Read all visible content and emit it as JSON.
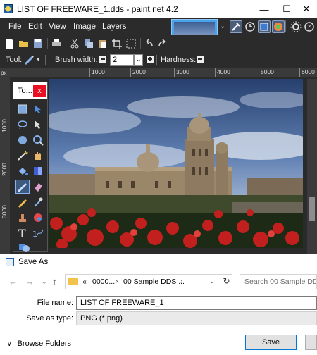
{
  "window": {
    "title": "LIST OF FREEWARE_1.dds - paint.net 4.2",
    "controls": {
      "minimize": "—",
      "maximize": "☐",
      "close": "✕"
    }
  },
  "menu": [
    "File",
    "Edit",
    "View",
    "Image",
    "Layers"
  ],
  "toolbar2": {
    "tool_label": "Tool:",
    "brush_width_label": "Brush width:",
    "brush_width_value": "2",
    "hardness_label": "Hardness:"
  },
  "ruler": {
    "unit": "px",
    "h_ticks": [
      "1000",
      "2000",
      "3000",
      "4000",
      "5000",
      "6000"
    ],
    "v_ticks": [
      "1000",
      "2000",
      "3000"
    ]
  },
  "tools_palette": {
    "title": "To...",
    "close": "x"
  },
  "colors": {
    "app_dark": "#2b2b2b",
    "accent_blue": "#0078d7",
    "close_red": "#e81123"
  },
  "save_dialog": {
    "title": "Save As",
    "breadcrumb": [
      "«",
      "0000...",
      "›",
      "00 Sample DDS ...",
      "›"
    ],
    "search_placeholder": "Search 00 Sample DDS ...",
    "file_name_label": "File name:",
    "file_name_value": "LIST OF FREEWARE_1",
    "save_as_type_label": "Save as type:",
    "save_as_type_value": "PNG (*.png)",
    "browse_folders": "Browse Folders",
    "save_button": "Save"
  }
}
